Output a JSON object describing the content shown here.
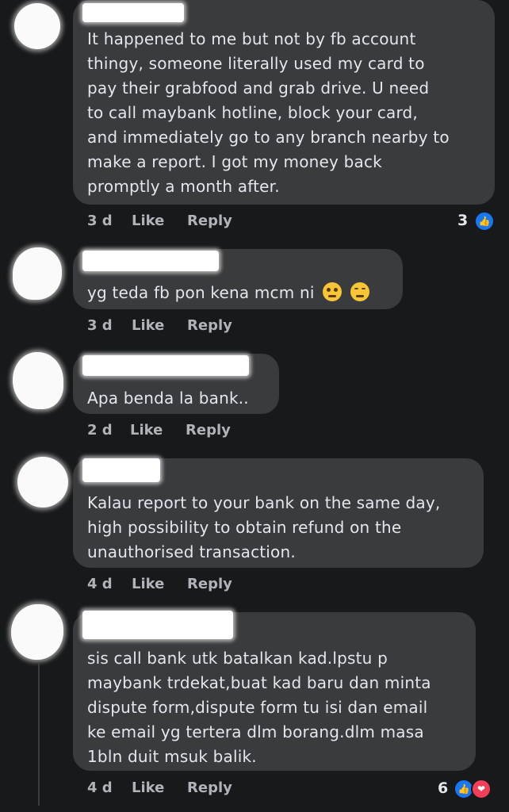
{
  "comments": [
    {
      "text_lines": [
        "It happened to me but not by fb account",
        "thingy, someone literally used my card to",
        "pay their grabfood and grab drive. U need",
        "to call maybank hotline, block your card,",
        "and immediately go to any branch nearby to",
        "make a report. I got my money back",
        "promptly a month after."
      ],
      "time": "3 d",
      "like": "Like",
      "reply": "Reply",
      "reaction_count": "3"
    },
    {
      "text": "yg teda fb pon kena mcm ni",
      "emojis": [
        "woozy-face-emoji",
        "relieved-face-emoji"
      ],
      "time": "3 d",
      "like": "Like",
      "reply": "Reply"
    },
    {
      "text": "Apa benda la bank..",
      "time": "2 d",
      "like": "Like",
      "reply": "Reply"
    },
    {
      "text_lines": [
        "Kalau report to your bank on the same day,",
        "high possibility to obtain refund on the",
        "unauthorised transaction."
      ],
      "time": "4 d",
      "like": "Like",
      "reply": "Reply"
    },
    {
      "text_lines": [
        "sis call bank utk batalkan kad.lpstu p",
        "maybank trdekat,buat kad baru dan minta",
        "dispute form,dispute form tu isi dan email",
        "ke email yg tertera dlm borang.dlm masa",
        "1bln duit msuk balik."
      ],
      "time": "4 d",
      "like": "Like",
      "reply": "Reply",
      "reaction_count": "6"
    }
  ],
  "colors": {
    "background": "#18191a",
    "bubble": "#3a3b3c",
    "text": "#e4e6eb",
    "muted": "#b0b3b8",
    "like_blue": "#1877f2",
    "love_red": "#f33e58"
  },
  "icons": [
    "like-reaction-icon",
    "love-reaction-icon"
  ]
}
